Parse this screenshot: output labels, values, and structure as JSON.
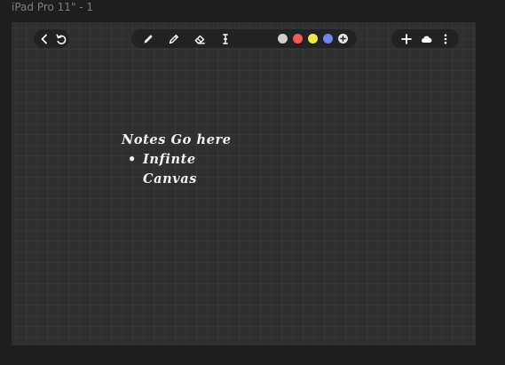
{
  "frame": {
    "label": "iPad Pro 11\" - 1"
  },
  "toolbar_left": {
    "back_icon": "chevron-left-icon",
    "undo_icon": "undo-icon"
  },
  "toolbar_center": {
    "tools": [
      "pen-icon",
      "pencil-icon",
      "eraser-icon",
      "text-cursor-icon"
    ],
    "colors": [
      "#cfcfcf",
      "#f05a55",
      "#f4e64a",
      "#6b86ef"
    ],
    "add_color_icon": "plus-circle-icon"
  },
  "toolbar_right": {
    "icons": [
      "plus-icon",
      "cloud-icon",
      "more-vertical-icon"
    ]
  },
  "canvas_note": {
    "heading": "Notes Go here",
    "bullets": [
      "Infinte Canvas"
    ]
  }
}
